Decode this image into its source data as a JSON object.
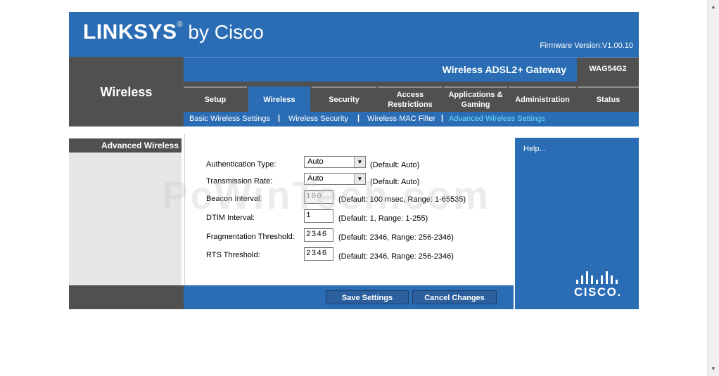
{
  "header": {
    "brand": "LINKSYS",
    "brand_suffix": "by Cisco",
    "firmware": "Firmware Version:V1.00.10"
  },
  "product": {
    "name": "Wireless ADSL2+ Gateway",
    "model": "WAG54G2"
  },
  "section_title": "Wireless",
  "tabs": [
    {
      "label": "Setup",
      "active": false
    },
    {
      "label": "Wireless",
      "active": true
    },
    {
      "label": "Security",
      "active": false
    },
    {
      "label": "Access\nRestrictions",
      "active": false
    },
    {
      "label": "Applications &\nGaming",
      "active": false
    },
    {
      "label": "Administration",
      "active": false
    },
    {
      "label": "Status",
      "active": false
    }
  ],
  "subnav": {
    "items": [
      "Basic Wireless Settings",
      "Wireless Security",
      "Wireless MAC Filter",
      "Advanced Wireless Settings"
    ],
    "separator": "|",
    "current": "Advanced Wireless Settings"
  },
  "sidebar": {
    "header": "Advanced Wireless"
  },
  "form": {
    "auth_type": {
      "label": "Authentication Type:",
      "value": "Auto",
      "hint": "(Default: Auto)"
    },
    "tx_rate": {
      "label": "Transmission Rate:",
      "value": "Auto",
      "hint": "(Default: Auto)"
    },
    "beacon": {
      "label": "Beacon Interval:",
      "value": "100",
      "hint": "(Default: 100 msec, Range: 1-65535)"
    },
    "dtim": {
      "label": "DTIM Interval:",
      "value": "1",
      "hint": "(Default: 1, Range: 1-255)"
    },
    "frag": {
      "label": "Fragmentation Threshold:",
      "value": "2346",
      "hint": "(Default: 2346, Range: 256-2346)"
    },
    "rts": {
      "label": "RTS Threshold:",
      "value": "2346",
      "hint": "(Default: 2346, Range: 256-2346)"
    }
  },
  "help": {
    "label": "Help..."
  },
  "buttons": {
    "save": "Save Settings",
    "cancel": "Cancel Changes"
  },
  "cisco_logo": "CISCO.",
  "watermark": "PcWinTech.com",
  "colors": {
    "blue": "#2b6db5",
    "dark_gray": "#505050",
    "subnav_current": "#66ddff"
  }
}
